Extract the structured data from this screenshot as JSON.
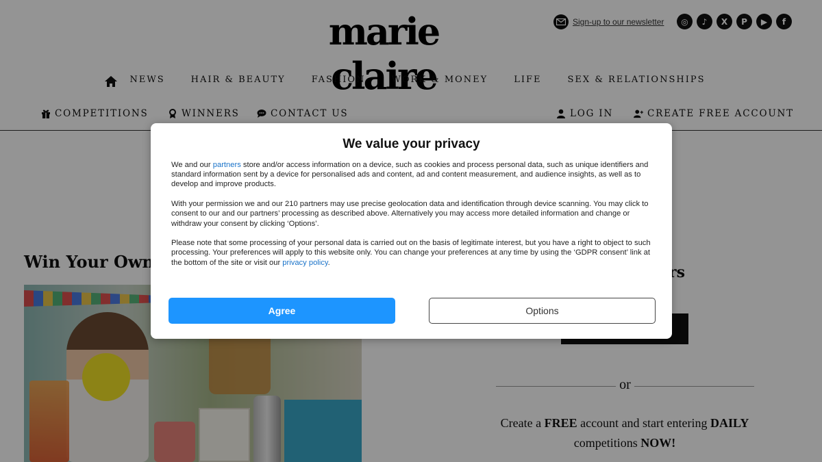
{
  "header": {
    "logo": "marie claire",
    "newsletter_label": "Sign-up to our newsletter",
    "socials": [
      {
        "icon": "instagram-icon",
        "glyph": "◎"
      },
      {
        "icon": "tiktok-icon",
        "glyph": "♪"
      },
      {
        "icon": "x-icon",
        "glyph": "X"
      },
      {
        "icon": "pinterest-icon",
        "glyph": "P"
      },
      {
        "icon": "youtube-icon",
        "glyph": "▶"
      },
      {
        "icon": "facebook-icon",
        "glyph": "f"
      }
    ]
  },
  "main_nav": {
    "items": [
      "NEWS",
      "HAIR & BEAUTY",
      "FASHION",
      "WORK & MONEY",
      "LIFE",
      "SEX & RELATIONSHIPS"
    ]
  },
  "sub_nav": {
    "competitions": "COMPETITIONS",
    "winners": "WINNERS",
    "contact": "CONTACT US",
    "login": "LOG IN",
    "create_account": "CREATE FREE ACCOUNT"
  },
  "page": {
    "title": "Win Your Own",
    "side_heading": "ers",
    "or": "or",
    "create_pre": "Create a ",
    "create_free": "FREE",
    "create_mid": " account and start entering ",
    "create_daily": "DAILY",
    "create_line2": "competitions ",
    "create_now": "NOW!"
  },
  "modal": {
    "title": "We value your privacy",
    "p1_before": "We and our ",
    "p1_link": "partners",
    "p1_after": " store and/or access information on a device, such as cookies and process personal data, such as unique identifiers and standard information sent by a device for personalised ads and content, ad and content measurement, and audience insights, as well as to develop and improve products.",
    "p2": "With your permission we and our 210 partners may use precise geolocation data and identification through device scanning. You may click to consent to our and our partners’ processing as described above. Alternatively you may access more detailed information and change or withdraw your consent by clicking ‘Options’.",
    "p3_before": "Please note that some processing of your personal data is carried out on the basis of legitimate interest, but you have a right to object to such processing. Your preferences will apply to this website only. You can change your preferences at any time by using the ‘GDPR consent’ link at the bottom of the site or visit our ",
    "p3_link": "privacy policy",
    "p3_after": ".",
    "agree_label": "Agree",
    "options_label": "Options"
  },
  "colors": {
    "agree_button": "#1d95ff",
    "link": "#1a73c9",
    "overlay": "rgba(0,0,0,0.42)"
  }
}
